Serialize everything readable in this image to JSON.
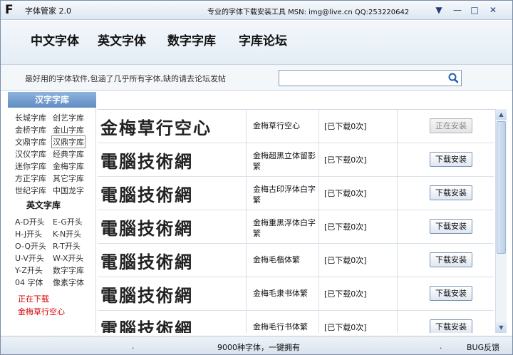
{
  "titlebar": {
    "logo": "F",
    "app_title": "字体管家 2.0",
    "slogan": "专业的字体下载安装工具 MSN: img@live.cn  QQ:253220642",
    "min_glyph": "▼",
    "minimize_glyph": "—",
    "maximize_glyph": "□",
    "close_glyph": "✕"
  },
  "nav": [
    "中文字体",
    "英文字体",
    "数字字库",
    "字库论坛"
  ],
  "search": {
    "hint": "最好用的字体软件,包涵了几乎所有字体,缺的请去论坛发帖",
    "value": ""
  },
  "sidebar": {
    "header": "汉字字库",
    "chinese_links": [
      [
        "长城字库",
        "创艺字库"
      ],
      [
        "金桥字库",
        "金山字库"
      ],
      [
        "文鼎字库",
        "汉鼎字库"
      ],
      [
        "汉仪字库",
        "经典字库"
      ],
      [
        "迷你字库",
        "金梅字库"
      ],
      [
        "方正字库",
        "其它字库"
      ],
      [
        "世纪字库",
        "中国龙字"
      ]
    ],
    "selected": "汉鼎字库",
    "english_header": "英文字库",
    "english_links": [
      [
        "A-D开头",
        "E-G开头"
      ],
      [
        "H-J开头",
        "K-N开头"
      ],
      [
        "O-Q开头",
        "R-T开头"
      ],
      [
        "U-V开头",
        "W-X开头"
      ],
      [
        "Y-Z开头",
        "数字字库"
      ],
      [
        "04 字体",
        "像素字体"
      ]
    ],
    "downloading_label": "正在下载",
    "downloading_name": "金梅草行空心"
  },
  "fonts": [
    {
      "preview": "金梅草行空心",
      "name": "金梅草行空心",
      "count": "[已下载0次]",
      "button": "正在安装",
      "installing": true
    },
    {
      "preview": "電腦技術網",
      "name": "金梅超黑立体留影繁",
      "count": "[已下载0次]",
      "button": "下载安装",
      "installing": false
    },
    {
      "preview": "電腦技術網",
      "name": "金梅古印浮体白字繁",
      "count": "[已下载0次]",
      "button": "下载安装",
      "installing": false
    },
    {
      "preview": "電腦技術網",
      "name": "金梅重黑浮体白字繁",
      "count": "[已下载0次]",
      "button": "下载安装",
      "installing": false
    },
    {
      "preview": "電腦技術網",
      "name": "金梅毛楷体繁",
      "count": "[已下载0次]",
      "button": "下载安装",
      "installing": false
    },
    {
      "preview": "電腦技術網",
      "name": "金梅毛隶书体繁",
      "count": "[已下载0次]",
      "button": "下载安装",
      "installing": false
    },
    {
      "preview": "電腦技術網",
      "name": "金梅毛行书体繁",
      "count": "[已下载0次]",
      "button": "下载安装",
      "installing": false
    }
  ],
  "status": {
    "left_dot": ".",
    "center": "9000种字体，一键拥有",
    "right_dot": ".",
    "feedback": "BUG反馈"
  },
  "colors": {
    "accent": "#5f8cc3",
    "downloading_red": "#d40000"
  }
}
